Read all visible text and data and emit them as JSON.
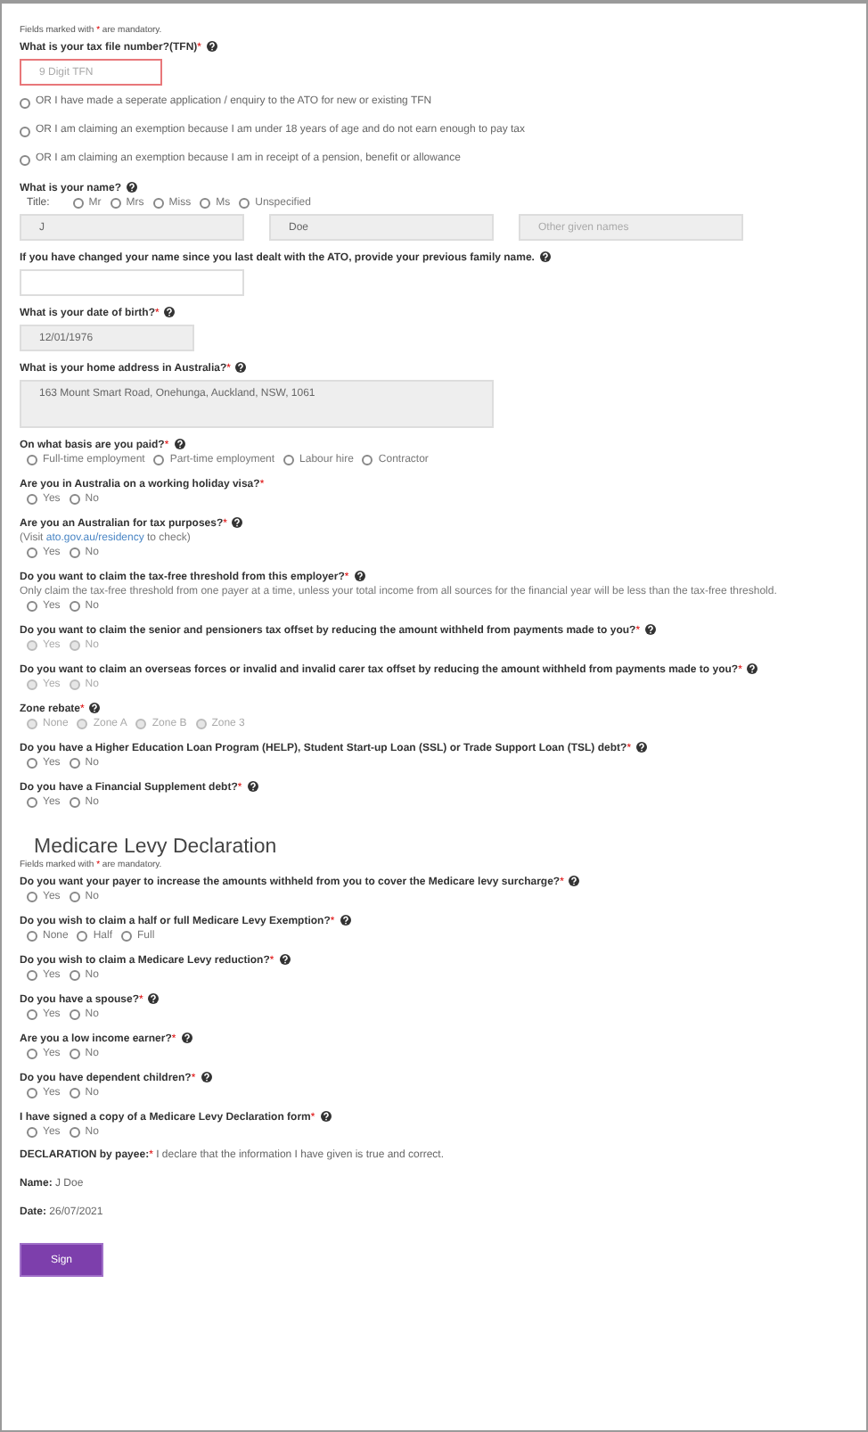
{
  "blocks": [
    {
      "kind": "note",
      "before": "Fields marked with ",
      "mark": "*",
      "after": " are mandatory."
    },
    {
      "kind": "question",
      "label": "What is your tax file number?(TFN)",
      "required_mark": "*",
      "help": true,
      "fields": [
        {
          "kind": "tfn",
          "placeholder": "9 Digit TFN",
          "readonly": false,
          "invalid": true
        }
      ]
    },
    {
      "kind": "choice",
      "label": "OR I have made a seperate application / enquiry to the ATO for new or existing TFN",
      "selected": false
    },
    {
      "kind": "choice",
      "label": "OR I am claiming an exemption because I am under 18 years of age and do not earn enough to pay tax",
      "selected": false
    },
    {
      "kind": "choice",
      "label": "OR I am claiming an exemption because I am in receipt of a pension, benefit or allowance",
      "selected": false
    },
    {
      "kind": "question",
      "label": "What is your name?",
      "help": true,
      "disabled": false,
      "prefix": "Title:",
      "options": [
        {
          "label": "Mr",
          "selected": false
        },
        {
          "label": "Mrs",
          "selected": false
        },
        {
          "label": "Miss",
          "selected": false
        },
        {
          "label": "Ms",
          "selected": false
        },
        {
          "label": "Unspecified",
          "selected": false
        }
      ],
      "fields": [
        {
          "kind": "name",
          "value": "J",
          "readonly": true,
          "invalid": false
        },
        {
          "kind": "name",
          "value": "Doe",
          "readonly": true,
          "invalid": false
        },
        {
          "kind": "name",
          "placeholder": "Other given names",
          "readonly": true,
          "invalid": false
        }
      ]
    },
    {
      "kind": "question",
      "label": "If you have changed your name since you last dealt with the ATO, provide your previous family name.",
      "help": true,
      "fields": [
        {
          "kind": "name",
          "readonly": false,
          "invalid": false
        }
      ]
    },
    {
      "kind": "question",
      "label": "What is your date of birth?",
      "required_mark": "*",
      "help": true,
      "fields": [
        {
          "kind": "date",
          "value": "12/01/1976",
          "readonly": true,
          "invalid": false
        }
      ]
    },
    {
      "kind": "question",
      "label": "What is your home address in Australia?",
      "required_mark": "*",
      "help": true,
      "fields": [
        {
          "kind": "address",
          "value": "163 Mount Smart Road, Onehunga, Auckland, NSW, 1061",
          "readonly": true,
          "invalid": false
        }
      ]
    },
    {
      "kind": "question",
      "label": "On what basis are you paid?",
      "required_mark": "*",
      "help": true,
      "disabled": false,
      "options": [
        {
          "label": "Full-time employment",
          "selected": false
        },
        {
          "label": "Part-time employment",
          "selected": false
        },
        {
          "label": "Labour hire",
          "selected": false
        },
        {
          "label": "Contractor",
          "selected": false
        }
      ]
    },
    {
      "kind": "question",
      "label": "Are you in Australia on a working holiday visa?",
      "required_mark": "*",
      "help": false,
      "disabled": false,
      "options": [
        {
          "label": "Yes",
          "selected": false
        },
        {
          "label": "No",
          "selected": false
        }
      ]
    },
    {
      "kind": "question",
      "label": "Are you an Australian for tax purposes?",
      "required_mark": "*",
      "help": true,
      "disabled": false,
      "hint_before": "(Visit ",
      "hint_link": "ato.gov.au/residency",
      "hint_after": " to check)",
      "options": [
        {
          "label": "Yes",
          "selected": false
        },
        {
          "label": "No",
          "selected": false
        }
      ]
    },
    {
      "kind": "question",
      "label": "Do you want to claim the tax-free threshold from this employer?",
      "required_mark": "*",
      "help": true,
      "disabled": false,
      "hint": "Only claim the tax-free threshold from one payer at a time, unless your total income from all sources for the financial year will be less than the tax-free threshold.",
      "options": [
        {
          "label": "Yes",
          "selected": false
        },
        {
          "label": "No",
          "selected": false
        }
      ]
    },
    {
      "kind": "question",
      "label": "Do you want to claim the senior and pensioners tax offset by reducing the amount withheld from payments made to you?",
      "required_mark": "*",
      "help": true,
      "disabled": true,
      "options": [
        {
          "label": "Yes",
          "selected": false
        },
        {
          "label": "No",
          "selected": false
        }
      ]
    },
    {
      "kind": "question",
      "label": "Do you want to claim an overseas forces or invalid and invalid carer tax offset by reducing the amount withheld from payments made to you?",
      "required_mark": "*",
      "help": true,
      "disabled": true,
      "options": [
        {
          "label": "Yes",
          "selected": false
        },
        {
          "label": "No",
          "selected": false
        }
      ]
    },
    {
      "kind": "question",
      "label": "Zone rebate",
      "required_mark": "*",
      "help": true,
      "disabled": true,
      "options": [
        {
          "label": "None",
          "selected": false
        },
        {
          "label": "Zone A",
          "selected": false
        },
        {
          "label": "Zone B",
          "selected": false
        },
        {
          "label": "Zone 3",
          "selected": false
        }
      ]
    },
    {
      "kind": "question",
      "label": "Do you have a Higher Education Loan Program (HELP), Student Start-up Loan (SSL) or Trade Support Loan (TSL) debt?",
      "required_mark": "*",
      "help": true,
      "disabled": false,
      "options": [
        {
          "label": "Yes",
          "selected": false
        },
        {
          "label": "No",
          "selected": false
        }
      ]
    },
    {
      "kind": "question",
      "label": "Do you have a Financial Supplement debt?",
      "required_mark": "*",
      "help": true,
      "disabled": false,
      "options": [
        {
          "label": "Yes",
          "selected": false
        },
        {
          "label": "No",
          "selected": false
        }
      ]
    },
    {
      "kind": "heading",
      "text": "Medicare Levy Declaration"
    },
    {
      "kind": "note",
      "before": "Fields marked with ",
      "mark": "*",
      "after": " are mandatory."
    },
    {
      "kind": "question",
      "label": "Do you want your payer to increase the amounts withheld from you to cover the Medicare levy surcharge?",
      "required_mark": "*",
      "help": true,
      "disabled": false,
      "options": [
        {
          "label": "Yes",
          "selected": false
        },
        {
          "label": "No",
          "selected": false
        }
      ]
    },
    {
      "kind": "question",
      "label": "Do you wish to claim a half or full Medicare Levy Exemption?",
      "required_mark": "*",
      "help": true,
      "disabled": false,
      "options": [
        {
          "label": "None",
          "selected": false
        },
        {
          "label": "Half",
          "selected": false
        },
        {
          "label": "Full",
          "selected": false
        }
      ]
    },
    {
      "kind": "question",
      "label": "Do you wish to claim a Medicare Levy reduction?",
      "required_mark": "*",
      "help": true,
      "disabled": false,
      "options": [
        {
          "label": "Yes",
          "selected": false
        },
        {
          "label": "No",
          "selected": false
        }
      ]
    },
    {
      "kind": "question",
      "label": "Do you have a spouse?",
      "required_mark": "*",
      "help": true,
      "disabled": false,
      "options": [
        {
          "label": "Yes",
          "selected": false
        },
        {
          "label": "No",
          "selected": false
        }
      ]
    },
    {
      "kind": "question",
      "label": "Are you a low income earner?",
      "required_mark": "*",
      "help": true,
      "disabled": false,
      "options": [
        {
          "label": "Yes",
          "selected": false
        },
        {
          "label": "No",
          "selected": false
        }
      ]
    },
    {
      "kind": "question",
      "label": "Do you have dependent children?",
      "required_mark": "*",
      "help": true,
      "disabled": false,
      "options": [
        {
          "label": "Yes",
          "selected": false
        },
        {
          "label": "No",
          "selected": false
        }
      ]
    },
    {
      "kind": "question",
      "label": "I have signed a copy of a Medicare Levy Declaration form",
      "required_mark": "*",
      "help": true,
      "disabled": false,
      "options": [
        {
          "label": "Yes",
          "selected": false
        },
        {
          "label": "No",
          "selected": false
        }
      ]
    },
    {
      "kind": "statement",
      "label": "DECLARATION by payee:",
      "required_mark": "*",
      "text": "I declare that the information I have given is true and correct."
    },
    {
      "kind": "statement",
      "label": "Name:",
      "text": "J Doe"
    },
    {
      "kind": "statement",
      "label": "Date:",
      "text": "26/07/2021"
    },
    {
      "kind": "button",
      "text": "Sign"
    }
  ]
}
